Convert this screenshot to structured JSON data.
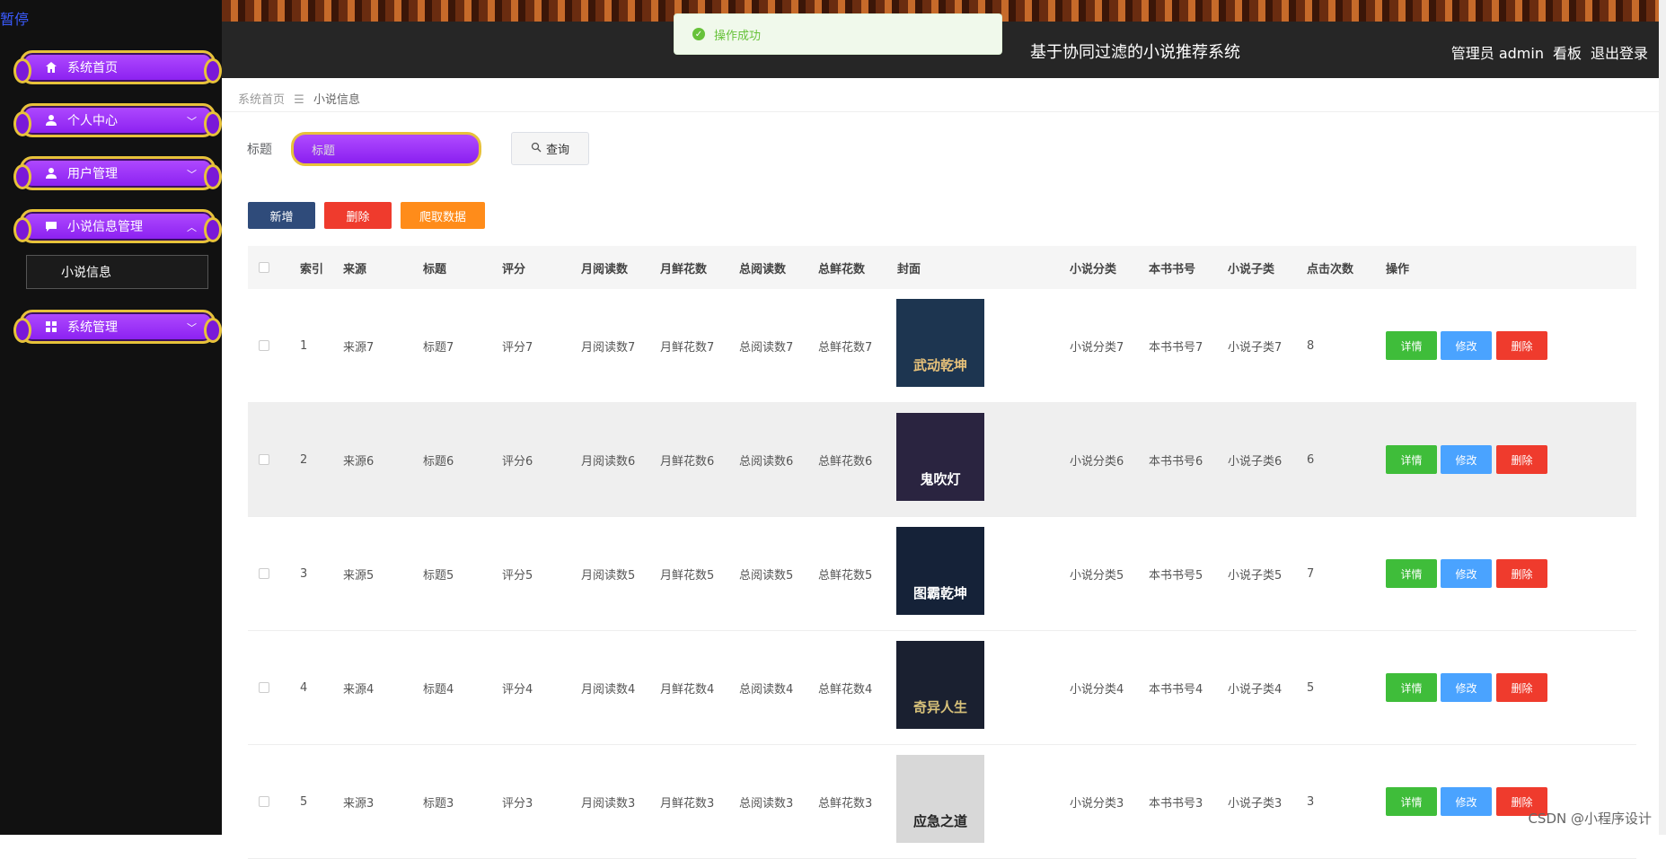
{
  "sidebar": {
    "pause": "暂停",
    "items": [
      {
        "label": "系统首页",
        "icon": "home-icon"
      },
      {
        "label": "个人中心",
        "icon": "user-icon"
      },
      {
        "label": "用户管理",
        "icon": "user-icon"
      },
      {
        "label": "小说信息管理",
        "icon": "chat-icon"
      },
      {
        "label": "系统管理",
        "icon": "grid-icon"
      }
    ],
    "submenu": "小说信息"
  },
  "header": {
    "title": "基于协同过滤的小说推荐系统",
    "user": "管理员 admin",
    "dashboard": "看板",
    "logout": "退出登录"
  },
  "toast": "操作成功",
  "breadcrumb": {
    "home": "系统首页",
    "sep": "☰",
    "current": "小说信息"
  },
  "search": {
    "label": "标题",
    "placeholder": "标题",
    "button": "查询"
  },
  "actions": {
    "add": "新增",
    "delete": "删除",
    "crawl": "爬取数据"
  },
  "colors": {
    "add": "#2f4b7a",
    "delete": "#ef3b2d",
    "crawl": "#ff8c1a",
    "detail": "#3fbd3a",
    "edit": "#4aa3ff",
    "remove": "#ef3b2d",
    "purple": "#9a33f7",
    "gold": "#e7c23a"
  },
  "table": {
    "headers": [
      "索引",
      "来源",
      "标题",
      "评分",
      "月阅读数",
      "月鲜花数",
      "总阅读数",
      "总鲜花数",
      "封面",
      "小说分类",
      "本书书号",
      "小说子类",
      "点击次数",
      "操作"
    ],
    "rows": [
      {
        "index": "1",
        "source": "来源7",
        "title": "标题7",
        "rating": "评分7",
        "monthly_reads": "月阅读数7",
        "monthly_flowers": "月鲜花数7",
        "total_reads": "总阅读数7",
        "total_flowers": "总鲜花数7",
        "category": "小说分类7",
        "book_no": "本书书号7",
        "subcategory": "小说子类7",
        "clicks": "8",
        "cover_text": "武动乾坤"
      },
      {
        "index": "2",
        "source": "来源6",
        "title": "标题6",
        "rating": "评分6",
        "monthly_reads": "月阅读数6",
        "monthly_flowers": "月鲜花数6",
        "total_reads": "总阅读数6",
        "total_flowers": "总鲜花数6",
        "category": "小说分类6",
        "book_no": "本书书号6",
        "subcategory": "小说子类6",
        "clicks": "6",
        "cover_text": "鬼吹灯"
      },
      {
        "index": "3",
        "source": "来源5",
        "title": "标题5",
        "rating": "评分5",
        "monthly_reads": "月阅读数5",
        "monthly_flowers": "月鲜花数5",
        "total_reads": "总阅读数5",
        "total_flowers": "总鲜花数5",
        "category": "小说分类5",
        "book_no": "本书书号5",
        "subcategory": "小说子类5",
        "clicks": "7",
        "cover_text": "图霸乾坤"
      },
      {
        "index": "4",
        "source": "来源4",
        "title": "标题4",
        "rating": "评分4",
        "monthly_reads": "月阅读数4",
        "monthly_flowers": "月鲜花数4",
        "total_reads": "总阅读数4",
        "total_flowers": "总鲜花数4",
        "category": "小说分类4",
        "book_no": "本书书号4",
        "subcategory": "小说子类4",
        "clicks": "5",
        "cover_text": "奇异人生"
      },
      {
        "index": "5",
        "source": "来源3",
        "title": "标题3",
        "rating": "评分3",
        "monthly_reads": "月阅读数3",
        "monthly_flowers": "月鲜花数3",
        "total_reads": "总阅读数3",
        "total_flowers": "总鲜花数3",
        "category": "小说分类3",
        "book_no": "本书书号3",
        "subcategory": "小说子类3",
        "clicks": "3",
        "cover_text": "应急之道"
      }
    ],
    "ops": {
      "detail": "详情",
      "edit": "修改",
      "remove": "删除"
    }
  },
  "watermark": "CSDN @小程序设计"
}
